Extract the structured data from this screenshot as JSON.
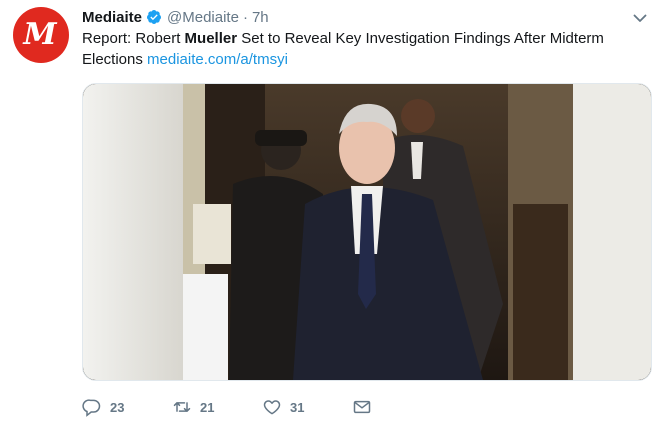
{
  "tweet": {
    "avatar_letter": "M",
    "author_name": "Mediaite",
    "handle": "@Mediaite",
    "separator": "·",
    "time": "7h",
    "text_before": "Report: Robert ",
    "text_bold": "Mueller",
    "text_after": " Set to Reveal Key Investigation Findings After Midterm Elections ",
    "link": "mediaite.com/a/tmsyi",
    "counts": {
      "replies": "23",
      "retweets": "21",
      "likes": "31"
    }
  },
  "colors": {
    "avatar": "#e0291f",
    "link": "#1b95e0",
    "verified": "#1da1f2",
    "muted": "#657786"
  },
  "icons": [
    "verified-icon",
    "chevron-down-icon",
    "reply-icon",
    "retweet-icon",
    "like-icon",
    "message-icon"
  ]
}
